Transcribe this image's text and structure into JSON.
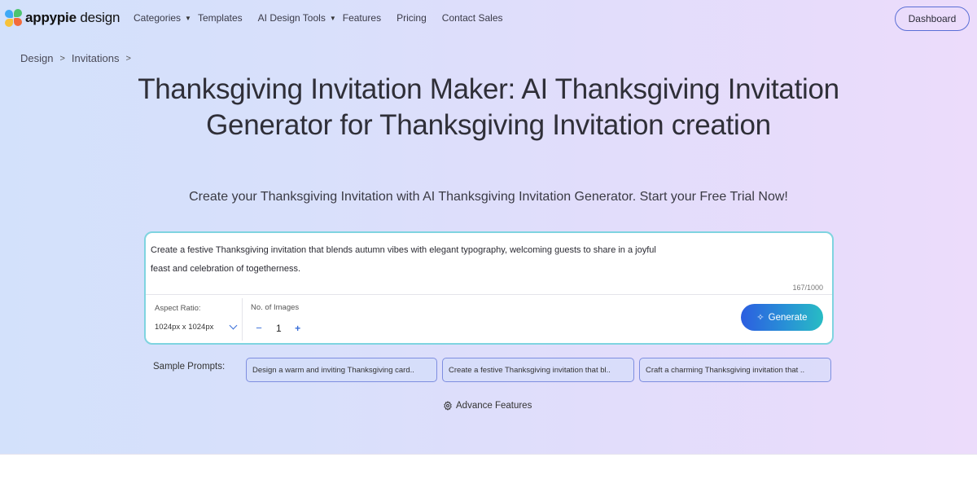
{
  "header": {
    "logo": {
      "brand": "appypie",
      "suffix": "design"
    },
    "nav": [
      {
        "label": "Categories",
        "has_dropdown": true
      },
      {
        "label": "Templates",
        "has_dropdown": false
      },
      {
        "label": "AI Design Tools",
        "has_dropdown": true
      },
      {
        "label": "Features",
        "has_dropdown": false
      },
      {
        "label": "Pricing",
        "has_dropdown": false
      },
      {
        "label": "Contact Sales",
        "has_dropdown": false
      }
    ],
    "dashboard_label": "Dashboard"
  },
  "breadcrumb": [
    {
      "label": "Design"
    },
    {
      "label": "Invitations"
    }
  ],
  "hero": {
    "title": "Thanksgiving Invitation Maker: AI Thanksgiving Invitation Generator for Thanksgiving Invitation creation",
    "subtitle": "Create your Thanksgiving Invitation with AI Thanksgiving Invitation Generator. Start your Free Trial Now!"
  },
  "prompt_card": {
    "prompt_line1": "Create a festive Thanksgiving invitation that blends autumn vibes with elegant typography, welcoming guests to share in a joyful",
    "prompt_line2": "feast and celebration of togetherness.",
    "char_counter": "167/1000",
    "aspect_ratio": {
      "label": "Aspect Ratio:",
      "value": "1024px x 1024px"
    },
    "num_images": {
      "label": "No. of Images",
      "value": "1",
      "minus": "−",
      "plus": "+"
    },
    "generate_label": "Generate",
    "colors": {
      "border": "#7fd4e0",
      "generate_start": "#2c5ee0",
      "generate_end": "#28bcc4"
    }
  },
  "sample_prompts": {
    "label": "Sample Prompts:",
    "items": [
      "Design a warm and inviting Thanksgiving card..",
      "Create a festive Thanksgiving invitation that bl..",
      "Craft a charming Thanksgiving invitation that .."
    ]
  },
  "advance_features_label": "Advance Features"
}
